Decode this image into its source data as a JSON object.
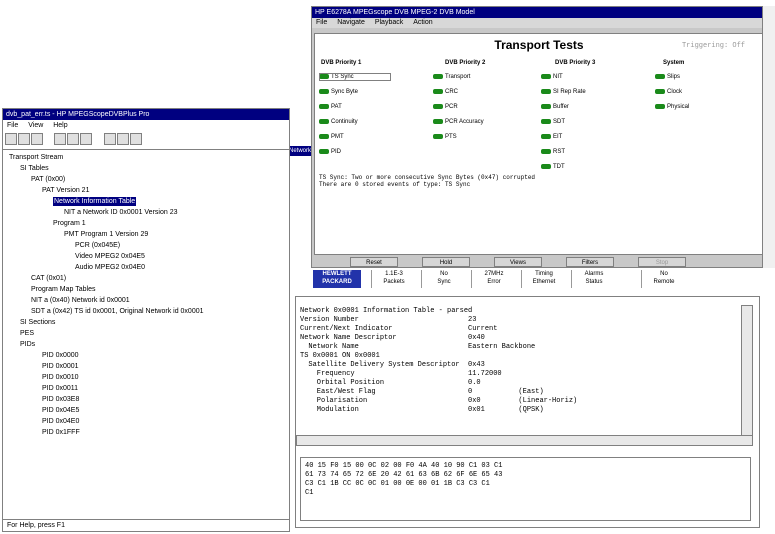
{
  "transport_window": {
    "title": "HP E6278A MPEGscope DVB MPEG-2 DVB Model",
    "menus": [
      "File",
      "Navigate",
      "Playback",
      "Action"
    ],
    "heading": "Transport Tests",
    "trigger": "Triggering: Off",
    "columns": [
      "DVB Priority 1",
      "DVB Priority 2",
      "DVB Priority 3",
      "System"
    ],
    "col1": [
      "TS Sync",
      "Sync Byte",
      "PAT",
      "Continuity",
      "PMT",
      "PID"
    ],
    "col2": [
      "Transport",
      "CRC",
      "PCR",
      "PCR Accuracy",
      "PTS"
    ],
    "col3": [
      "NIT",
      "SI Rep Rate",
      "Buffer",
      "SDT",
      "EIT",
      "RST",
      "TDT"
    ],
    "col4": [
      "Slips",
      "Clock",
      "Physical"
    ],
    "message_line1": "TS Sync: Two or more consecutive Sync Bytes (0x47) corrupted",
    "message_line2": "There are 0 stored events of type: TS Sync",
    "buttons": [
      "Reset",
      "Hold",
      "Views",
      "Filters",
      "Stop"
    ],
    "counters": [
      {
        "line1": "1.1E-3",
        "line2": "Packets"
      },
      {
        "line1": "No",
        "line2": "Sync"
      },
      {
        "line1": "27MHz",
        "line2": "Error"
      },
      {
        "line1": "Timing",
        "line2": "Ethernet"
      },
      {
        "line1": "Alarms",
        "line2": "Status"
      },
      {
        "line1": "No",
        "line2": "Remote"
      }
    ],
    "hp_logo_line1": "HEWLETT",
    "hp_logo_line2": "PACKARD"
  },
  "left_window": {
    "title": "dvb_pat_err.ts - HP MPEGScopeDVBPlus Pro",
    "menus": [
      "File",
      "View",
      "Help"
    ],
    "status": "For Help, press F1",
    "tree": [
      {
        "text": "Transport Stream",
        "indent": 0
      },
      {
        "text": "SI Tables",
        "indent": 1
      },
      {
        "text": "PAT (0x00)",
        "indent": 2
      },
      {
        "text": "PAT Version 21",
        "indent": 3
      },
      {
        "text": "Network Information Table",
        "indent": 4,
        "selected": true
      },
      {
        "text": "NIT a Network ID 0x0001 Version 23",
        "indent": 5
      },
      {
        "text": "Program 1",
        "indent": 4
      },
      {
        "text": "PMT Program 1 Version 29",
        "indent": 5
      },
      {
        "text": "PCR (0x045E)",
        "indent": 6
      },
      {
        "text": "Video MPEG2 0x04E5",
        "indent": 6
      },
      {
        "text": "Audio MPEG2 0x04E0",
        "indent": 6
      },
      {
        "text": "CAT (0x01)",
        "indent": 2
      },
      {
        "text": "Program Map Tables",
        "indent": 2
      },
      {
        "text": "NIT a (0x40) Network id 0x0001",
        "indent": 2
      },
      {
        "text": "SDT a (0x42) TS id 0x0001, Original Network id 0x0001",
        "indent": 2
      },
      {
        "text": "SI Sections",
        "indent": 1
      },
      {
        "text": "PES",
        "indent": 1
      },
      {
        "text": "PIDs",
        "indent": 1
      },
      {
        "text": "PID 0x0000",
        "indent": 3
      },
      {
        "text": "PID 0x0001",
        "indent": 3
      },
      {
        "text": "PID 0x0010",
        "indent": 3
      },
      {
        "text": "PID 0x0011",
        "indent": 3
      },
      {
        "text": "PID 0x03E8",
        "indent": 3
      },
      {
        "text": "PID 0x04E5",
        "indent": 3
      },
      {
        "text": "PID 0x04E0",
        "indent": 3
      },
      {
        "text": "PID 0x1FFF",
        "indent": 3
      }
    ]
  },
  "network_tab": "Network",
  "detail_window": {
    "rows": [
      "Network 0x0001 Information Table - parsed",
      "Version Number                          23",
      "Current/Next Indicator                  Current",
      "Network Name Descriptor                 0x40",
      "  Network Name                          Eastern Backbone",
      "TS 0x0001 ON 0x0001",
      "  Satellite Delivery System Descriptor  0x43",
      "    Frequency                           11.72000",
      "    Orbital Position                    0.0",
      "    East/West Flag                      0           (East)",
      "    Polarisation                        0x0         (Linear-Horiz)",
      "    Modulation                          0x01        (QPSK)"
    ],
    "hex": [
      "40 15 F0 15 00 0C 02 00 F0 4A 40 10 90 C1 03 C1",
      "61 73 74 65 72 6E 20 42 61 63 6B 62 6F 6E 65 43",
      "C3 C1 1B CC 0C 0C 01 00 0E 00 01 1B C3 C3 C1",
      "C1"
    ]
  }
}
